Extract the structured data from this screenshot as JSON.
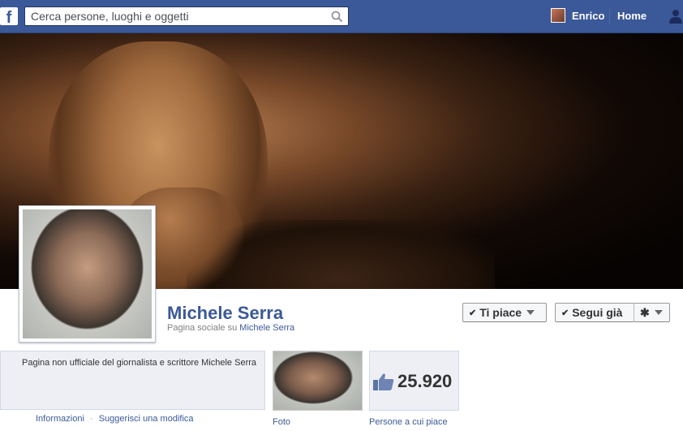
{
  "topbar": {
    "logo": "f",
    "search_placeholder": "Cerca persone, luoghi e oggetti",
    "user_name": "Enrico",
    "home_label": "Home"
  },
  "icons": {
    "logo": "facebook-logo-icon",
    "search": "search-icon",
    "friends": "friend-requests-icon",
    "like": "thumbs-up-icon",
    "gear": "gear-icon"
  },
  "page": {
    "name": "Michele Serra",
    "category_prefix": "Pagina sociale su",
    "category_link": "Michele Serra"
  },
  "actions": {
    "like_label": "Ti piace",
    "follow_label": "Segui già",
    "check_glyph": "✔",
    "gear_glyph": "✱"
  },
  "about": {
    "text": "Pagina non ufficiale del giornalista e scrittore Michele Serra",
    "info_link": "Informazioni",
    "separator": "·",
    "suggest_link": "Suggerisci una modifica"
  },
  "apps": {
    "photos_label": "Foto",
    "likes_count": "25.920",
    "likes_label": "Persone a cui piace"
  },
  "colors": {
    "brand": "#3b5998",
    "panel": "#edeff4"
  }
}
